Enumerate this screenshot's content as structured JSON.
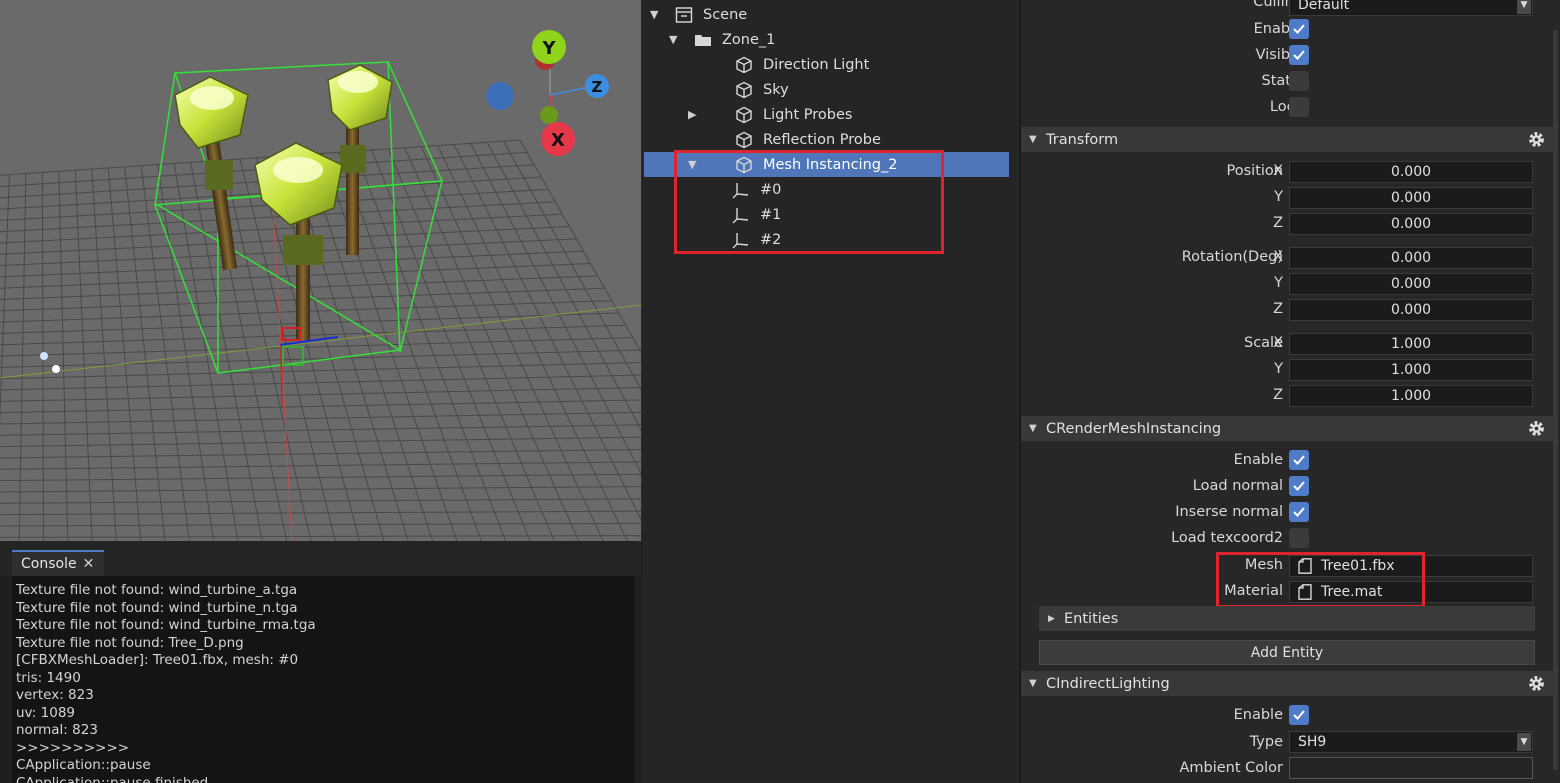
{
  "viewport": {
    "gizmo": {
      "y_label": "Y",
      "z_label": "Z",
      "x_label": "X",
      "colors": {
        "y": "#8fd41a",
        "z": "#3d8ee0",
        "x": "#e7384a",
        "neutral": "#3d6fb8"
      }
    }
  },
  "console": {
    "tab_label": "Console",
    "close_glyph": "✕",
    "lines": [
      "Texture file not found: wind_turbine_a.tga",
      "Texture file not found: wind_turbine_n.tga",
      "Texture file not found: wind_turbine_rma.tga",
      "Texture file not found: Tree_D.png",
      "[CFBXMeshLoader]: Tree01.fbx, mesh: #0",
      "tris: 1490",
      "vertex: 823",
      "uv: 1089",
      "normal: 823",
      ">>>>>>>>>>",
      "CApplication::pause",
      "CApplication::pause finished"
    ]
  },
  "hierarchy": {
    "items": [
      {
        "label": "Scene",
        "icon": "scene-icon",
        "expanded": true
      },
      {
        "label": "Zone_1",
        "icon": "folder-icon",
        "expanded": true
      },
      {
        "label": "Direction Light",
        "icon": "cube-icon"
      },
      {
        "label": "Sky",
        "icon": "cube-icon"
      },
      {
        "label": "Light Probes",
        "icon": "cube-icon",
        "expanded": false
      },
      {
        "label": "Reflection Probe",
        "icon": "cube-icon"
      },
      {
        "label": "Mesh Instancing_2",
        "icon": "cube-icon",
        "expanded": true,
        "selected": true
      },
      {
        "label": "#0",
        "icon": "axis-icon"
      },
      {
        "label": "#1",
        "icon": "axis-icon"
      },
      {
        "label": "#2",
        "icon": "axis-icon"
      }
    ]
  },
  "inspector": {
    "culling": {
      "label": "Culling",
      "value": "Default"
    },
    "object": {
      "enable": {
        "label": "Enable",
        "checked": true
      },
      "visible": {
        "label": "Visible",
        "checked": true
      },
      "static": {
        "label": "Static",
        "checked": false
      },
      "lock": {
        "label": "Lock",
        "checked": false
      }
    },
    "transform": {
      "title": "Transform",
      "position": {
        "label": "Position",
        "x": "0.000",
        "y": "0.000",
        "z": "0.000"
      },
      "rotation": {
        "label": "Rotation(Deg)",
        "x": "0.000",
        "y": "0.000",
        "z": "0.000"
      },
      "scale": {
        "label": "Scale",
        "x": "1.000",
        "y": "1.000",
        "z": "1.000"
      },
      "axis": {
        "x": "X",
        "y": "Y",
        "z": "Z"
      }
    },
    "render_mesh_instancing": {
      "title": "CRenderMeshInstancing",
      "enable": {
        "label": "Enable",
        "checked": true
      },
      "load_normal": {
        "label": "Load normal",
        "checked": true
      },
      "inserse_normal": {
        "label": "Inserse normal",
        "checked": true
      },
      "load_texcoord2": {
        "label": "Load texcoord2",
        "checked": false
      },
      "mesh": {
        "label": "Mesh",
        "value": "Tree01.fbx"
      },
      "material": {
        "label": "Material",
        "value": "Tree.mat"
      },
      "entities_label": "Entities",
      "add_entity_label": "Add Entity"
    },
    "indirect_lighting": {
      "title": "CIndirectLighting",
      "enable": {
        "label": "Enable",
        "checked": true
      },
      "type": {
        "label": "Type",
        "value": "SH9"
      },
      "ambient_color": {
        "label": "Ambient Color",
        "value": ""
      }
    },
    "colors": {
      "accent": "#4e76b9",
      "highlight_box": "#e0242d"
    }
  }
}
